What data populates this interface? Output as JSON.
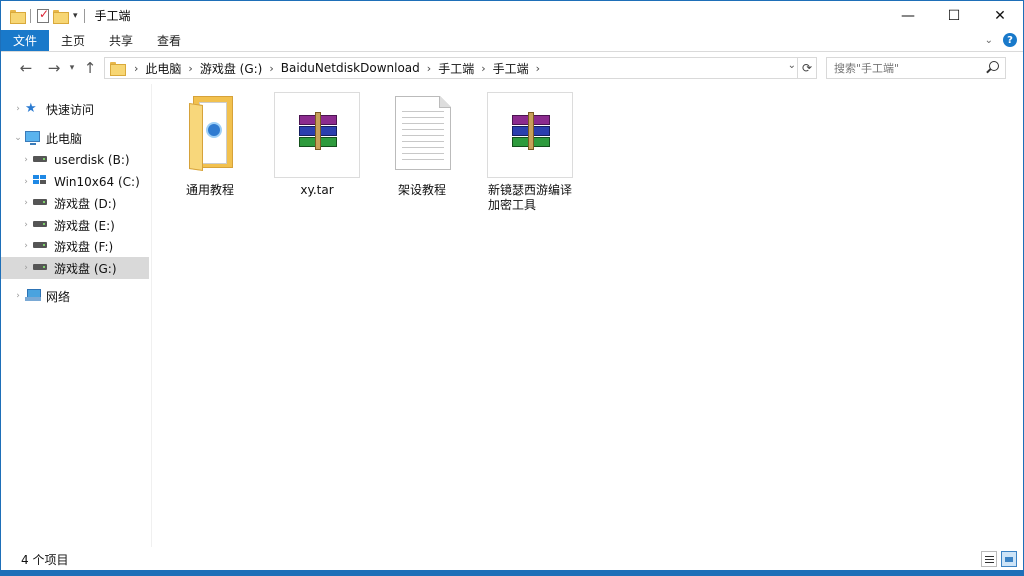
{
  "window": {
    "title": "手工端",
    "controls": {
      "minimize": "—",
      "maximize": "☐",
      "close": "✕"
    }
  },
  "ribbon": {
    "tabs": [
      "文件",
      "主页",
      "共享",
      "查看"
    ]
  },
  "nav": {
    "back": "←",
    "forward": "→",
    "recent": "▾",
    "up": "↑"
  },
  "address": {
    "crumbs": [
      "此电脑",
      "游戏盘 (G:)",
      "BaiduNetdiskDownload",
      "手工端",
      "手工端"
    ],
    "separator": "›"
  },
  "search": {
    "placeholder": "搜索\"手工端\""
  },
  "sidebar": {
    "items": [
      {
        "label": "快速访问",
        "icon": "star-icon"
      },
      {
        "label": "此电脑",
        "icon": "computer-icon"
      },
      {
        "label": "userdisk (B:)",
        "icon": "drive-icon"
      },
      {
        "label": "Win10x64 (C:)",
        "icon": "windows-drive-icon"
      },
      {
        "label": "游戏盘 (D:)",
        "icon": "drive-icon"
      },
      {
        "label": "游戏盘 (E:)",
        "icon": "drive-icon"
      },
      {
        "label": "游戏盘 (F:)",
        "icon": "drive-icon"
      },
      {
        "label": "游戏盘 (G:)",
        "icon": "drive-icon",
        "selected": true
      },
      {
        "label": "网络",
        "icon": "network-icon"
      }
    ]
  },
  "files": [
    {
      "name": "通用教程",
      "icon": "folder-icon"
    },
    {
      "name": "xy.tar",
      "icon": "winrar-archive-icon"
    },
    {
      "name": "架设教程",
      "icon": "text-document-icon"
    },
    {
      "name": "新镜瑟西游编译加密工具",
      "name_line1": "新镜瑟西游编译",
      "name_line2": "加密工具",
      "icon": "winrar-archive-icon"
    }
  ],
  "status": {
    "item_count": "4 个项目"
  },
  "colors": {
    "accent": "#1979ca",
    "selection": "#d9d9d9"
  }
}
